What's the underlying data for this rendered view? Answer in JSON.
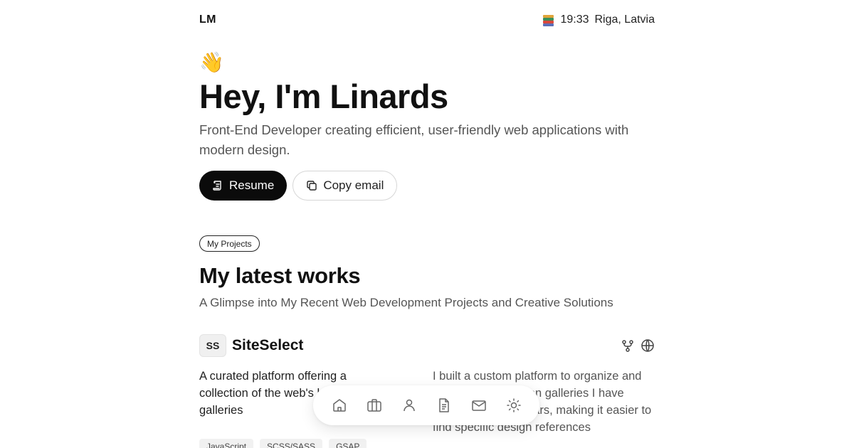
{
  "header": {
    "logo": "LM",
    "time": "19:33",
    "location": "Riga, Latvia",
    "clock_icon": "books-icon"
  },
  "hero": {
    "emoji": "👋",
    "title": "Hey, I'm Linards",
    "subtitle": "Front-End Developer creating efficient, user-friendly web applications with modern design.",
    "resume_label": "Resume",
    "copy_email_label": "Copy email"
  },
  "projects": {
    "pill": "My Projects",
    "title": "My latest works",
    "subtitle": "A Glimpse into My Recent Web Development Projects and Creative Solutions",
    "items": [
      {
        "badge": "SS",
        "name": "SiteSelect",
        "summary": "A curated platform offering a collection of the web's best design galleries",
        "description": "I built a custom platform to organize and showcase inspiration galleries I have curated over the years, making it easier to find specific design references",
        "tags": [
          "JavaScript",
          "SCSS/SASS",
          "GSAP"
        ]
      }
    ]
  },
  "dock": {
    "items": [
      "home-icon",
      "briefcase-icon",
      "user-icon",
      "document-icon",
      "mail-icon",
      "sun-icon"
    ]
  },
  "colors": {
    "text": "#111111",
    "muted": "#555555",
    "dark_button": "#0b0b0b"
  }
}
